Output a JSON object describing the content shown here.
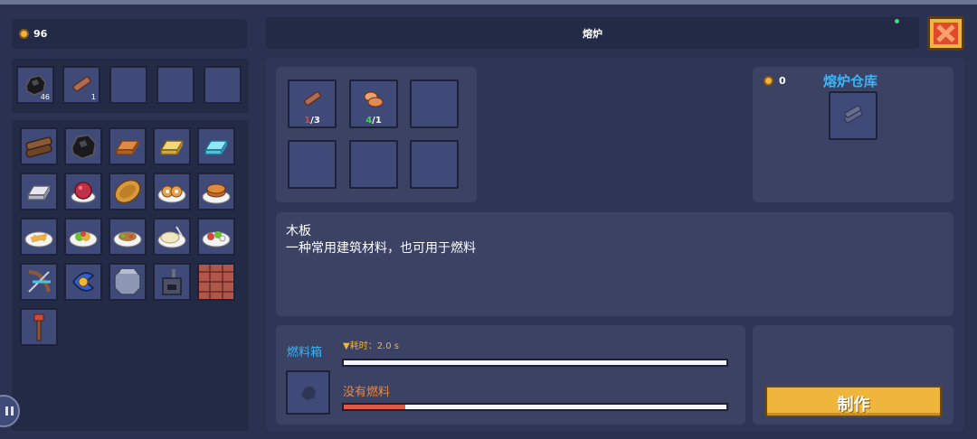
{
  "coins": "96",
  "title": "熔炉",
  "inventory_row": [
    {
      "icon": "coal-icon",
      "count": "46"
    },
    {
      "icon": "wood-plank-icon",
      "count": "1"
    },
    {
      "icon": "empty-slot",
      "count": ""
    },
    {
      "icon": "empty-slot",
      "count": ""
    },
    {
      "icon": "empty-slot",
      "count": ""
    }
  ],
  "recipes": [
    "wood-log-icon",
    "coal-icon",
    "copper-ingot-icon",
    "gold-ingot-icon",
    "diamond-ingot-icon",
    "iron-ingot-icon",
    "berry-bowl-icon",
    "pie-icon",
    "donut-plate-icon",
    "pancake-plate-icon",
    "fries-plate-icon",
    "salad-plate-icon",
    "meal-plate-icon",
    "rice-plate-icon",
    "sushi-plate-icon",
    "crossbow-icon",
    "boomerang-icon",
    "stone-block-icon",
    "furnace-icon",
    "brick-wall-icon",
    "torch-icon"
  ],
  "ingredients": [
    {
      "icon": "wood-plank-icon",
      "have": "1",
      "need": "/3",
      "have_color": "#e0453c"
    },
    {
      "icon": "meat-icon",
      "have": "4",
      "need": "/1",
      "have_color": "#48d05a"
    }
  ],
  "storage": {
    "title": "熔炉仓库",
    "coins": "0"
  },
  "description": {
    "name": "木板",
    "text": "一种常用建筑材料，也可用于燃料"
  },
  "fuel": {
    "label": "燃料箱",
    "time_label": "▼耗时：2.0 s",
    "time_progress": 0,
    "status": "没有燃料",
    "fuel_level": 0.16
  },
  "craft_button": "制作",
  "colors": {
    "accent": "#f0b53c",
    "label_blue": "#3db4f5",
    "warn_orange": "#f0883c",
    "close_red": "#e04a2a"
  }
}
